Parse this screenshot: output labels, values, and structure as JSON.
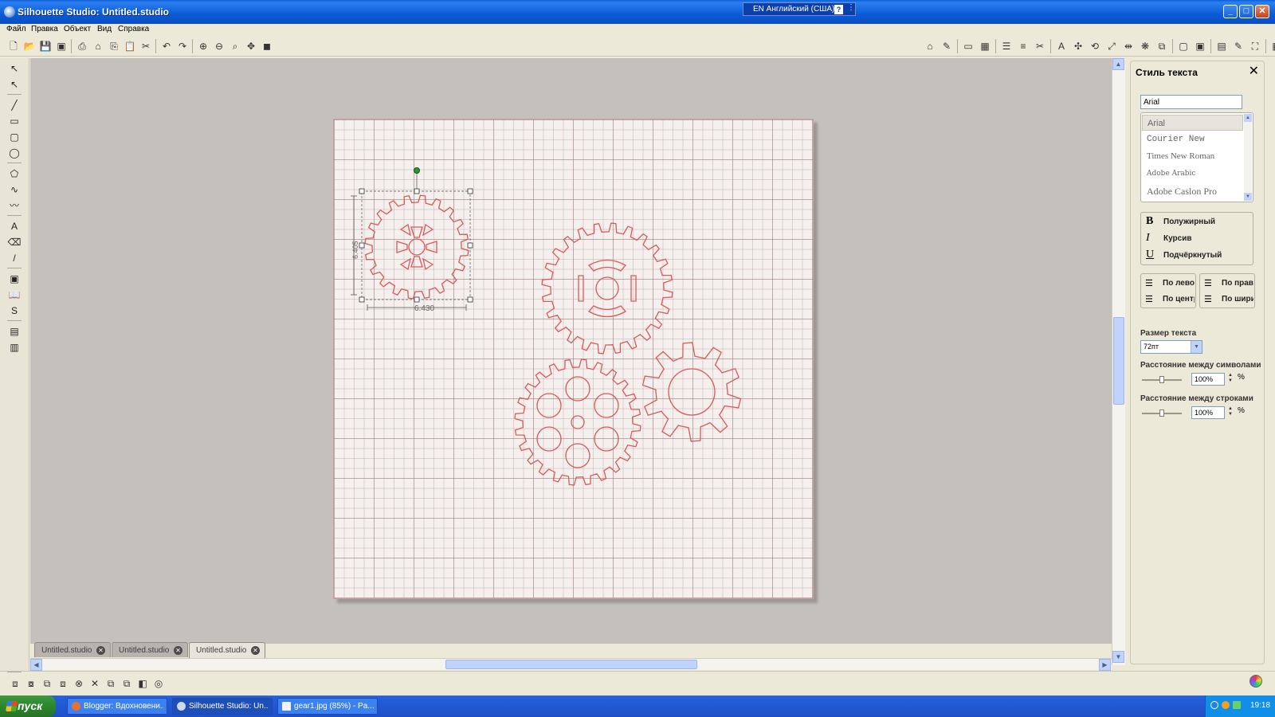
{
  "window": {
    "title": "Silhouette Studio: Untitled.studio",
    "lang_indicator": "EN Английский (США)",
    "help_glyph": "?",
    "buttons": {
      "minimize": "_",
      "maximize": "□",
      "close": "✕"
    }
  },
  "menu": [
    {
      "label": "Файл"
    },
    {
      "label": "Правка"
    },
    {
      "label": "Объект"
    },
    {
      "label": "Вид"
    },
    {
      "label": "Справка"
    }
  ],
  "toolbar_top_left": [
    {
      "icon": "new-document-icon",
      "glyph": "🗋"
    },
    {
      "icon": "open-folder-icon",
      "glyph": "📂"
    },
    {
      "icon": "save-icon",
      "glyph": "💾"
    },
    {
      "icon": "save-to-library-icon",
      "glyph": "▣"
    },
    {
      "icon": "print-icon",
      "glyph": "⎙"
    },
    {
      "icon": "send-to-cutter-icon",
      "glyph": "⌂"
    },
    {
      "icon": "copy-icon",
      "glyph": "⎘"
    },
    {
      "icon": "paste-icon",
      "glyph": "📋"
    },
    {
      "icon": "cut-icon",
      "glyph": "✂"
    },
    {
      "icon": "undo-icon",
      "glyph": "↶"
    },
    {
      "icon": "redo-icon",
      "glyph": "↷"
    },
    {
      "icon": "zoom-in-icon",
      "glyph": "⊕"
    },
    {
      "icon": "zoom-out-icon",
      "glyph": "⊖"
    },
    {
      "icon": "zoom-select-icon",
      "glyph": "⌕"
    },
    {
      "icon": "pan-icon",
      "glyph": "✥"
    },
    {
      "icon": "fit-to-page-icon",
      "glyph": "◼"
    }
  ],
  "toolbar_top_right": [
    {
      "icon": "page-setup-icon",
      "glyph": "⌂"
    },
    {
      "icon": "cut-settings-icon",
      "glyph": "✎"
    },
    {
      "icon": "registration-icon",
      "glyph": "▭"
    },
    {
      "icon": "grid-icon",
      "glyph": "▦"
    },
    {
      "icon": "line-style-icon",
      "glyph": "☰"
    },
    {
      "icon": "fill-icon",
      "glyph": "≡"
    },
    {
      "icon": "cut-style-icon",
      "glyph": "✂"
    },
    {
      "icon": "text-style-icon",
      "glyph": "A"
    },
    {
      "icon": "transform-icon",
      "glyph": "✣"
    },
    {
      "icon": "rotate-icon",
      "glyph": "⟲"
    },
    {
      "icon": "scale-icon",
      "glyph": "⤢"
    },
    {
      "icon": "move-icon",
      "glyph": "⇹"
    },
    {
      "icon": "replicate-icon",
      "glyph": "❋"
    },
    {
      "icon": "modify-icon",
      "glyph": "⧉"
    },
    {
      "icon": "offset-icon",
      "glyph": "▢"
    },
    {
      "icon": "trace-icon",
      "glyph": "▣"
    },
    {
      "icon": "library-icon",
      "glyph": "▤"
    },
    {
      "icon": "pencil-icon",
      "glyph": "✎"
    },
    {
      "icon": "fullscreen-icon",
      "glyph": "⛶"
    },
    {
      "icon": "store-icon",
      "glyph": "▦"
    }
  ],
  "toolbar_left": [
    {
      "icon": "select-tool-icon",
      "glyph": "↖"
    },
    {
      "icon": "edit-points-icon",
      "glyph": "↖"
    },
    {
      "icon": "line-tool-icon",
      "glyph": "╱"
    },
    {
      "icon": "rectangle-tool-icon",
      "glyph": "▭"
    },
    {
      "icon": "rounded-rectangle-tool-icon",
      "glyph": "▢"
    },
    {
      "icon": "ellipse-tool-icon",
      "glyph": "◯"
    },
    {
      "icon": "polygon-tool-icon",
      "glyph": "⬠"
    },
    {
      "icon": "curve-tool-icon",
      "glyph": "∿"
    },
    {
      "icon": "freehand-tool-icon",
      "glyph": "〰"
    },
    {
      "icon": "text-tool-icon",
      "glyph": "A"
    },
    {
      "icon": "eraser-tool-icon",
      "glyph": "⌫"
    },
    {
      "icon": "knife-tool-icon",
      "glyph": "/"
    },
    {
      "icon": "page-view-icon",
      "glyph": "▣"
    },
    {
      "icon": "library-view-icon",
      "glyph": "📖"
    },
    {
      "icon": "online-store-icon",
      "glyph": "S"
    },
    {
      "icon": "split-view-1-icon",
      "glyph": "▤"
    },
    {
      "icon": "split-view-2-icon",
      "glyph": "▥"
    }
  ],
  "doc_tabs": [
    {
      "label": "Untitled.studio",
      "close": "✕"
    },
    {
      "label": "Untitled.studio",
      "close": "✕"
    },
    {
      "label": "Untitled.studio",
      "close": "✕"
    }
  ],
  "selection": {
    "width_readout": "6.430",
    "height_readout": "6.405"
  },
  "toolbar_bottom": [
    {
      "icon": "group-icon",
      "glyph": "⧈"
    },
    {
      "icon": "ungroup-icon",
      "glyph": "⧇"
    },
    {
      "icon": "make-compound-icon",
      "glyph": "⧉"
    },
    {
      "icon": "release-compound-icon",
      "glyph": "⧈"
    },
    {
      "icon": "weld-icon",
      "glyph": "⊗"
    },
    {
      "icon": "delete-icon",
      "glyph": "✕"
    },
    {
      "icon": "bring-forward-icon",
      "glyph": "⧉"
    },
    {
      "icon": "send-backward-icon",
      "glyph": "⧉"
    },
    {
      "icon": "mirror-icon",
      "glyph": "◧"
    },
    {
      "icon": "target-icon",
      "glyph": "◎"
    }
  ],
  "panel": {
    "title": "Стиль текста",
    "close": "✕",
    "font_input": "Arial",
    "fonts": [
      "Arial",
      "Courier New",
      "Times New Roman",
      "Adobe Arabic",
      "Adobe Caslon Pro"
    ],
    "styles": [
      {
        "glyph": "B",
        "label": "Полужирный"
      },
      {
        "glyph": "I",
        "label": "Курсив"
      },
      {
        "glyph": "U",
        "label": "Подчёркнутый"
      }
    ],
    "align": [
      {
        "glyph": "☰",
        "label": "По левому"
      },
      {
        "glyph": "☰",
        "label": "По центру"
      },
      {
        "glyph": "☰",
        "label": "По правому"
      },
      {
        "glyph": "☰",
        "label": "По ширине"
      }
    ],
    "size_label": "Размер текста",
    "size_value": "72пт",
    "char_spacing_label": "Расстояние между символами",
    "char_spacing_value": "100%",
    "line_spacing_label": "Расстояние между строками",
    "line_spacing_value": "100%",
    "percent": "%"
  },
  "taskbar": {
    "start": "пуск",
    "tasks": [
      {
        "label": "Blogger: Вдохновени..."
      },
      {
        "label": "Silhouette Studio: Un..."
      },
      {
        "label": "gear1.jpg (85%) - Pa..."
      }
    ],
    "clock": "19:18"
  },
  "colors": {
    "accent": "#0a5fd8",
    "cut_line": "#d85a5a",
    "grid_paper": "#f5efee"
  }
}
